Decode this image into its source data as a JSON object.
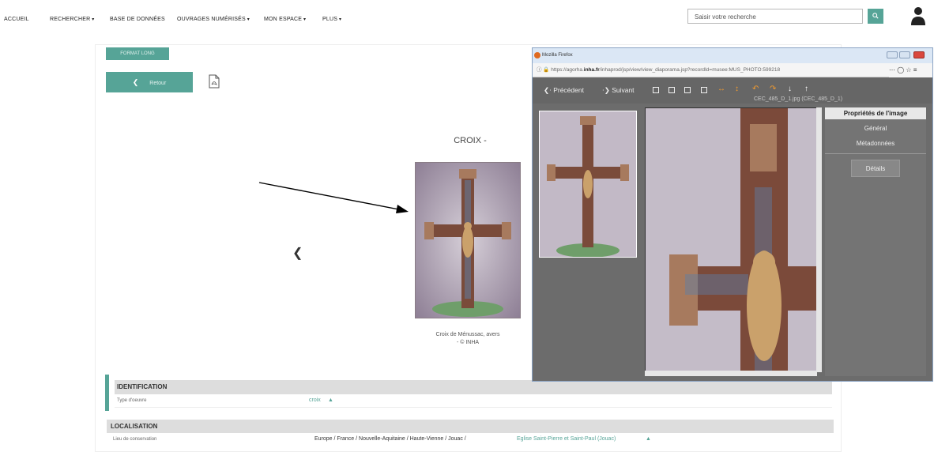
{
  "nav": {
    "items": [
      {
        "label": "ACCUEIL",
        "dropdown": false
      },
      {
        "label": "RECHERCHER",
        "dropdown": true
      },
      {
        "label": "BASE DE DONNÉES",
        "dropdown": false
      },
      {
        "label": "OUVRAGES NUMÉRISÉS",
        "dropdown": true
      },
      {
        "label": "MON ESPACE",
        "dropdown": true
      },
      {
        "label": "PLUS",
        "dropdown": true
      }
    ],
    "search_placeholder": "Saisir votre recherche",
    "search_icon": "search-icon",
    "user_icon": "user-icon"
  },
  "page": {
    "format_label": "FORMAT LONG",
    "back_label": "Retour",
    "title": "CROIX -",
    "caption_line1": "Croix de Ménussac, avers",
    "caption_line2": "- © INHA",
    "prev_icon": "chevron-left-icon"
  },
  "identification": {
    "header": "IDENTIFICATION",
    "label": "Type d'oeuvre",
    "value": "croix"
  },
  "localisation": {
    "header": "LOCALISATION",
    "label": "Lieu de conservation",
    "path": "Europe / France / Nouvelle-Aquitaine / Haute-Vienne / Jouac /",
    "link": "Eglise Saint-Pierre et Saint-Paul (Jouac)"
  },
  "popup": {
    "window_title": "Mozilla Firefox",
    "url_prefix": "https://agorha.",
    "url_domain": "inha.fr",
    "url_rest": "/inhaprod/jsp/view/view_diaporama.jsp?recordId=musee:MUS_PHOTO:599218",
    "prev_label": "Précédent",
    "next_label": "Suivant",
    "stub_label": "CEC_485_D_1.jpg (CEC_485_D_1)",
    "props_title": "Propriétés de l'image",
    "props_general": "Général",
    "props_meta": "Métadonnées",
    "props_details": "Détails"
  },
  "colors": {
    "accent": "#56a497",
    "popup_bg": "#6f6f6f",
    "orange": "#f09a30"
  }
}
